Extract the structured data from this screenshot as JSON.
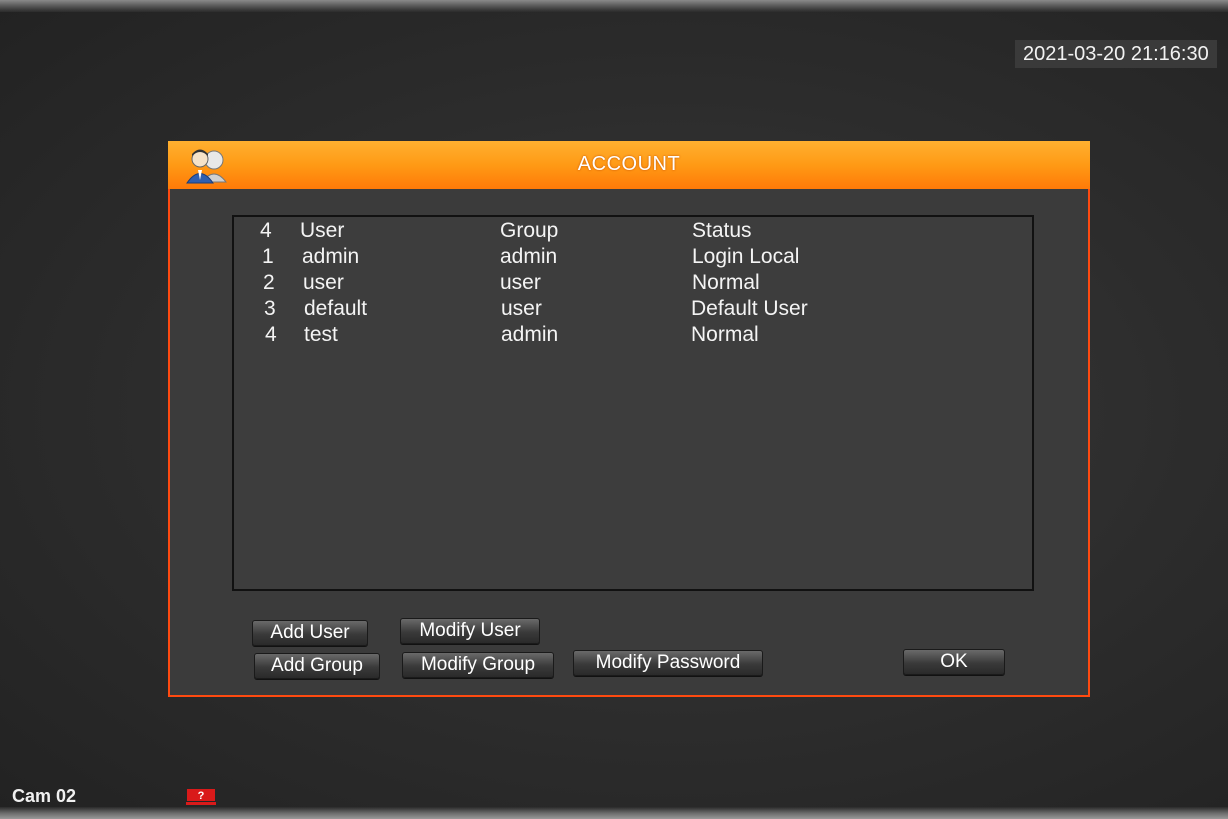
{
  "osd": {
    "datetime": "2021-03-20 21:16:30",
    "camera_label": "Cam 02"
  },
  "dialog": {
    "title": "ACCOUNT",
    "table": {
      "header": {
        "count": "4",
        "user": "User",
        "group": "Group",
        "status": "Status"
      },
      "rows": [
        {
          "index": "1",
          "user": "admin",
          "group": "admin",
          "status": "Login Local"
        },
        {
          "index": "2",
          "user": "user",
          "group": "user",
          "status": "Normal"
        },
        {
          "index": "3",
          "user": "default",
          "group": "user",
          "status": "Default User"
        },
        {
          "index": "4",
          "user": "test",
          "group": "admin",
          "status": "Normal"
        }
      ]
    },
    "buttons": {
      "add_user": "Add User",
      "modify_user": "Modify User",
      "add_group": "Add Group",
      "modify_group": "Modify Group",
      "modify_password": "Modify Password",
      "ok": "OK"
    }
  },
  "colors": {
    "title_bar": "#ff9a15",
    "frame_border": "#ff4a10",
    "dialog_bg": "#3b3b3b",
    "alarm_icon": "#d91a1a"
  },
  "icons": {
    "title": "user-account-icon",
    "alarm": "alarm-icon"
  }
}
